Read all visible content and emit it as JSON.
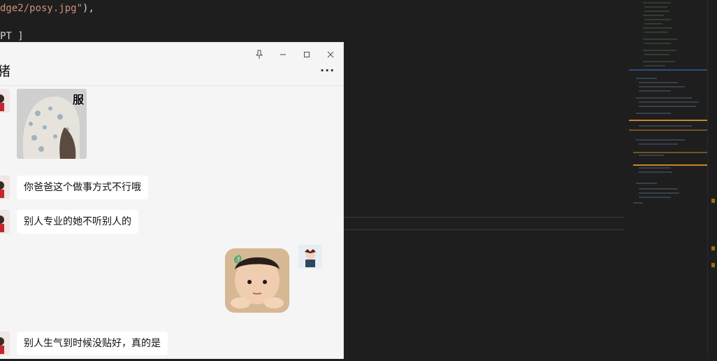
{
  "editor": {
    "code_line_1_string": "dge2/posy.jpg\"",
    "code_line_1_tail": "),",
    "code_line_2": "PT ]"
  },
  "chat": {
    "title": "猪",
    "more_label": "···",
    "window_buttons": {
      "pin": "📌",
      "minimize": "—",
      "maximize": "☐",
      "close": "✕"
    },
    "sticker1_text": "服",
    "messages": [
      {
        "side": "left",
        "text": "你爸爸这个做事方式不行哦"
      },
      {
        "side": "left",
        "text": "别人专业的她不听别人的"
      },
      {
        "side": "left",
        "text": "别人生气到时候没贴好，真的是"
      }
    ]
  },
  "colors": {
    "editor_bg": "#1e1e1e",
    "string": "#ce9178",
    "chat_bg": "#f5f5f5",
    "bubble_bg": "#ffffff"
  }
}
